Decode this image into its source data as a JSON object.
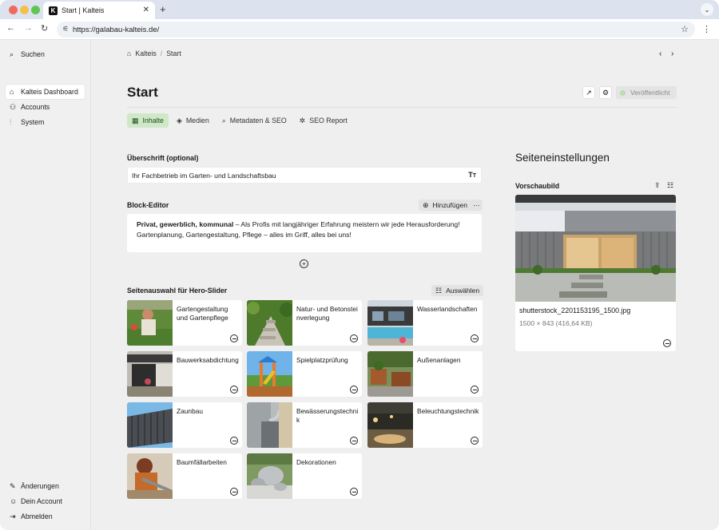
{
  "browser": {
    "tab_title": "Start | Kalteis",
    "tab_favicon": "K",
    "url": "https://galabau-kalteis.de/"
  },
  "sidebar": {
    "search": "Suchen",
    "items": [
      {
        "label": "Kalteis Dashboard",
        "icon": "home-icon"
      },
      {
        "label": "Accounts",
        "icon": "users-icon"
      },
      {
        "label": "System",
        "icon": "sliders-icon"
      }
    ],
    "bottom": [
      {
        "label": "Änderungen",
        "icon": "pencil-icon"
      },
      {
        "label": "Dein Account",
        "icon": "user-icon"
      },
      {
        "label": "Abmelden",
        "icon": "logout-icon"
      }
    ]
  },
  "breadcrumb": {
    "home": "Kalteis",
    "separator": "/",
    "current": "Start"
  },
  "page": {
    "title": "Start",
    "publish_label": "Veröffentlicht",
    "tabs": [
      {
        "label": "Inhalte",
        "icon": "grid-icon"
      },
      {
        "label": "Medien",
        "icon": "layers-icon"
      },
      {
        "label": "Metadaten & SEO",
        "icon": "search-icon"
      },
      {
        "label": "SEO Report",
        "icon": "bug-icon"
      }
    ]
  },
  "heading_field": {
    "label": "Überschrift (optional)",
    "value": "Ihr Fachbetrieb im Garten- und Landschaftsbau"
  },
  "block_editor": {
    "label": "Block-Editor",
    "add_label": "Hinzufügen",
    "text_bold": "Privat, gewerblich, kommunal",
    "text_rest": " – Als Profis mit langjähriger Erfahrung meistern wir jede Herausforderung! Gartenplanung, Gartengestaltung, Pflege – alles im Griff, alles bei uns!"
  },
  "hero_slider": {
    "label": "Seitenauswahl für Hero-Slider",
    "select_label": "Auswählen",
    "pages": [
      {
        "title": "Gartengestaltung und Gartenpflege"
      },
      {
        "title": "Natur- und Betonsteinverlegung"
      },
      {
        "title": "Wasserlandschaften"
      },
      {
        "title": "Bauwerksabdichtung"
      },
      {
        "title": "Spielplatzprüfung"
      },
      {
        "title": "Außenanlagen"
      },
      {
        "title": "Zaunbau"
      },
      {
        "title": "Bewässerungstechnik"
      },
      {
        "title": "Beleuchtungstechnik"
      },
      {
        "title": "Baumfällarbeiten"
      },
      {
        "title": "Dekorationen"
      }
    ]
  },
  "settings": {
    "heading": "Seiteneinstellungen",
    "preview_label": "Vorschaubild",
    "file_name": "shutterstock_2201153195_1500.jpg",
    "file_meta": "1500 × 843 (416,64 KB)"
  },
  "colors": {
    "accent_green": "#cfe8c8",
    "publish_dot": "#b7dfb0"
  }
}
